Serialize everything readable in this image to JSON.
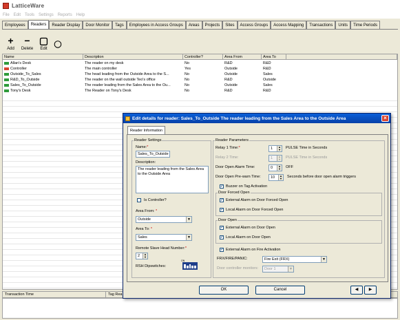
{
  "app": {
    "title": "LatticeWare",
    "menu": [
      "File",
      "Edit",
      "Tools",
      "Settings",
      "Reports",
      "Help"
    ]
  },
  "tabs": [
    "Employees",
    "Readers",
    "Reader Display",
    "Door Monitor",
    "Tags",
    "Employees in Access Groups",
    "Areas",
    "Projects",
    "Sites",
    "Access Groups",
    "Access Mapping",
    "Transactions",
    "Units",
    "Time Periods"
  ],
  "active_tab": "Readers",
  "toolbar": {
    "add": "Add",
    "delete": "Delete",
    "edit": "Edit"
  },
  "grid": {
    "columns": [
      "Name",
      "Description",
      "Controller?",
      "Area From",
      "Area To"
    ],
    "rows": [
      {
        "name": "Allan's Desk",
        "description": "The reader on my desk",
        "controller": "No",
        "area_from": "R&D",
        "area_to": "R&D",
        "icon": "reader-icon"
      },
      {
        "name": "Controller",
        "description": "The main controller",
        "controller": "Yes",
        "area_from": "Outside",
        "area_to": "R&D",
        "icon": "controller-icon"
      },
      {
        "name": "Outside_To_Sales",
        "description": "The head leading from the Outside Area to the S...",
        "controller": "No",
        "area_from": "Outside",
        "area_to": "Sales",
        "icon": "reader-icon"
      },
      {
        "name": "R&D_To_Outside",
        "description": "The reader on the wall outside Teo's office",
        "controller": "No",
        "area_from": "R&D",
        "area_to": "Outside",
        "icon": "reader-icon"
      },
      {
        "name": "Sales_To_Outside",
        "description": "The reader leading from the Sales Area to the Ou...",
        "controller": "No",
        "area_from": "Outside",
        "area_to": "Sales",
        "icon": "reader-icon"
      },
      {
        "name": "Tony's Desk",
        "description": "The Reader on Tony's Desk",
        "controller": "No",
        "area_from": "R&D",
        "area_to": "R&D",
        "icon": "reader-icon"
      }
    ]
  },
  "bottom": {
    "col1": "Transaction Time",
    "col2": "Tag Rea..."
  },
  "dialog": {
    "title": "Edit details for reader: Sales_To_Outside The reader leading from the Sales Area to the Outside Area",
    "tab": "Reader Information",
    "reader_settings": {
      "group": "Reader Settings",
      "name_label": "Name:",
      "name_value": "Sales_To_Outside",
      "description_label": "Description:",
      "description_value": "The reader leading from the Sales Area to the Outside Area",
      "is_controller": "Is Controller?",
      "area_from_label": "Area From:",
      "area_from_value": "Outside",
      "area_to_label": "Area To:",
      "area_to_value": "Sales",
      "remote_slave_label": "Remote Slave Head Number:",
      "remote_slave_value": "2",
      "rsh_label": "RSH Dipswitches:",
      "dip_on": "ON"
    },
    "reader_params": {
      "group": "Reader Parameters",
      "relay1_label": "Relay 1 Time:",
      "relay1_value": "1",
      "relay1_suffix": "PULSE Time in Seconds",
      "relay2_label": "Relay 2 Time:",
      "relay2_value": "1",
      "relay2_suffix": "PULSE Time in Seconds",
      "alarm_time_label": "Door Open Alarm Time:",
      "alarm_time_value": "0",
      "alarm_time_suffix": "OFF",
      "prewarn_label": "Door Open Pre-warn Time:",
      "prewarn_value": "10",
      "prewarn_suffix": "Seconds before door open alarm triggers",
      "buzzer": "Buzzer on Tag Activation",
      "forced_group": "Door Forced Open",
      "ext_forced": "External Alarm on Door Forced Open",
      "local_forced": "Local Alarm on Door Forced Open",
      "open_group": "Door Open",
      "ext_open": "External Alarm on Door Open",
      "local_open": "Local Alarm on Door Open",
      "ext_fire": "External Alarm on Fire Activation",
      "frx_label": "FRX/FIRE/PANIC:",
      "frx_value": "Fire Exit (FRX)",
      "monitor_label": "Door controller monitors:",
      "monitor_value": "Door 1"
    },
    "ok": "OK",
    "cancel": "Cancel"
  }
}
